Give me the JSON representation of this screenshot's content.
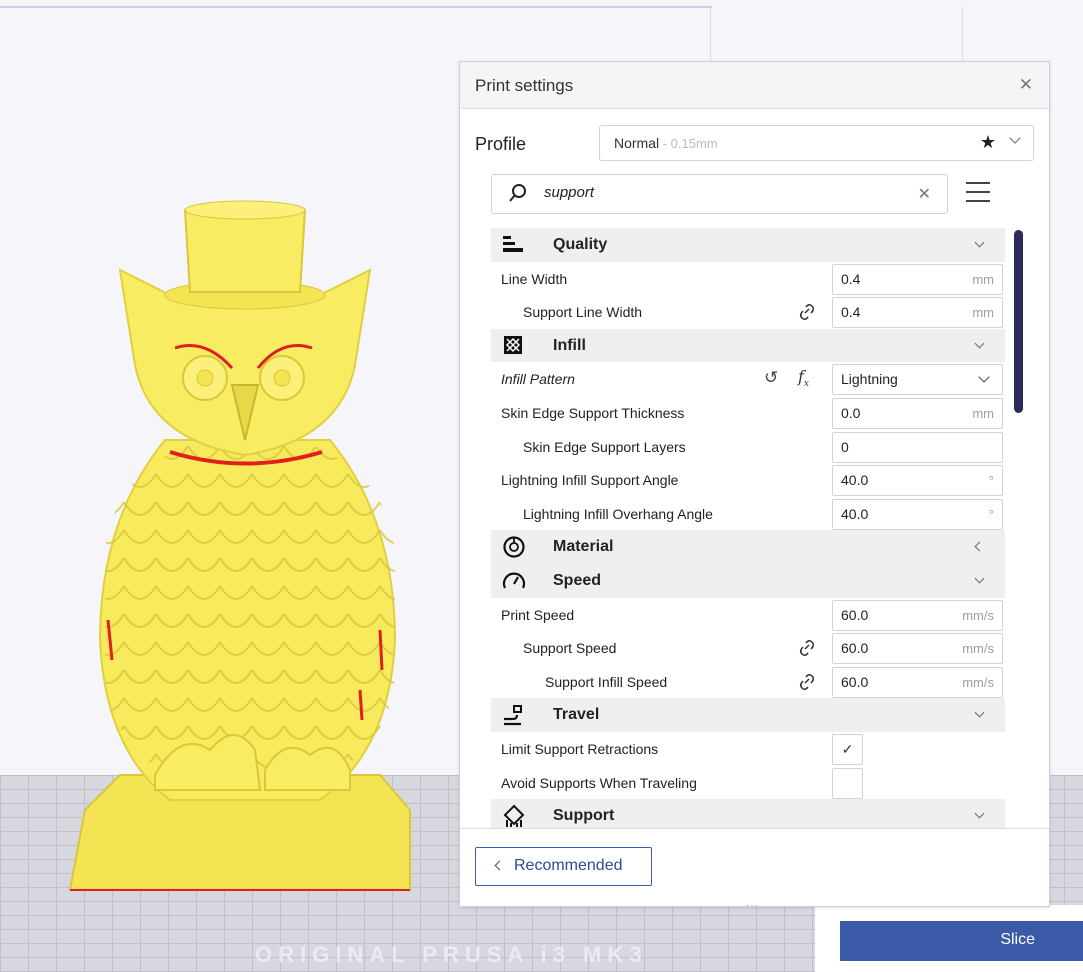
{
  "panel": {
    "title": "Print settings",
    "profile_label": "Profile",
    "profile_name": "Normal",
    "profile_sub": " - 0.15mm"
  },
  "search": {
    "value": "support"
  },
  "categories": {
    "quality": "Quality",
    "infill": "Infill",
    "material": "Material",
    "speed": "Speed",
    "travel": "Travel",
    "support": "Support"
  },
  "settings": {
    "line_width": {
      "label": "Line Width",
      "value": "0.4",
      "unit": "mm"
    },
    "support_line_width": {
      "label": "Support Line Width",
      "value": "0.4",
      "unit": "mm"
    },
    "infill_pattern": {
      "label": "Infill Pattern",
      "value": "Lightning"
    },
    "skin_edge_thickness": {
      "label": "Skin Edge Support Thickness",
      "value": "0.0",
      "unit": "mm"
    },
    "skin_edge_layers": {
      "label": "Skin Edge Support Layers",
      "value": "0"
    },
    "lightning_support_angle": {
      "label": "Lightning Infill Support Angle",
      "value": "40.0",
      "unit": "°"
    },
    "lightning_overhang_angle": {
      "label": "Lightning Infill Overhang Angle",
      "value": "40.0",
      "unit": "°"
    },
    "print_speed": {
      "label": "Print Speed",
      "value": "60.0",
      "unit": "mm/s"
    },
    "support_speed": {
      "label": "Support Speed",
      "value": "60.0",
      "unit": "mm/s"
    },
    "support_infill_speed": {
      "label": "Support Infill Speed",
      "value": "60.0",
      "unit": "mm/s"
    },
    "limit_support_retractions": {
      "label": "Limit Support Retractions",
      "checked": true,
      "mark": "✓"
    },
    "avoid_supports_traveling": {
      "label": "Avoid Supports When Traveling",
      "checked": false
    }
  },
  "footer": {
    "recommended_label": "Recommended"
  },
  "actions": {
    "slice_label": "Slice"
  },
  "floor_text": "ORIGINAL PRUSA i3 MK3",
  "colors": {
    "accent": "#3b5aa8",
    "model": "#f7ea5c",
    "overhang": "#e02020"
  },
  "icons": {
    "close": "close-icon",
    "star": "star-icon",
    "search": "search-icon",
    "menu": "menu-icon",
    "link": "link-icon",
    "reset": "reset-icon",
    "fx": "function-icon"
  }
}
